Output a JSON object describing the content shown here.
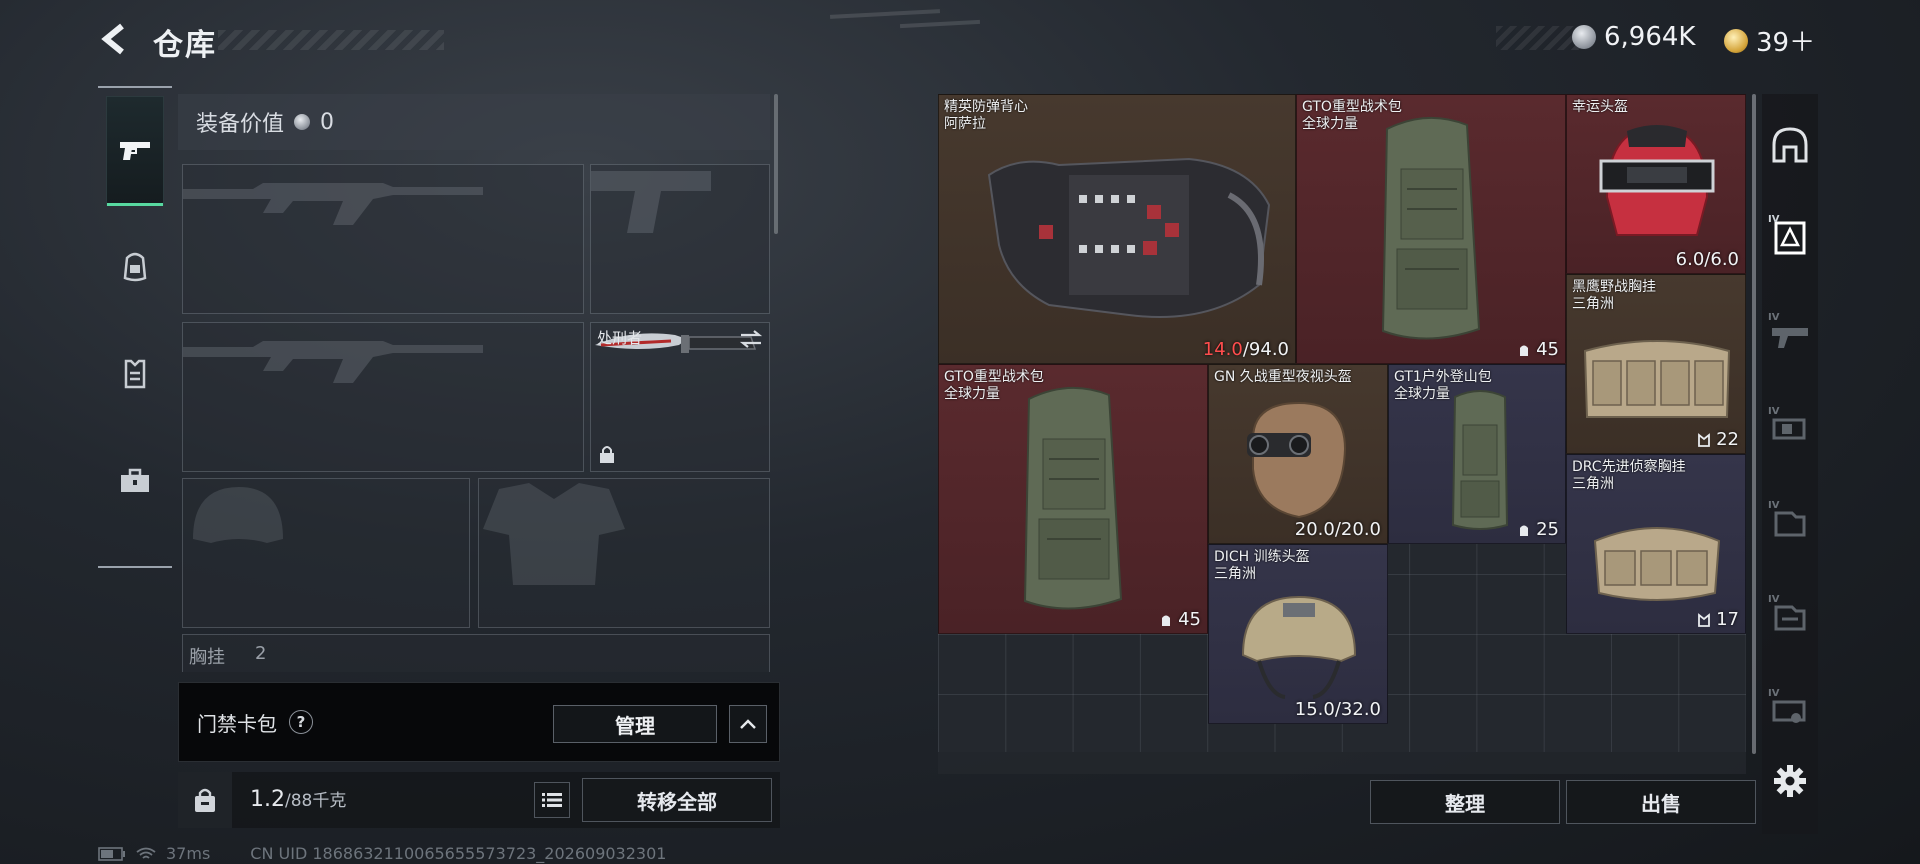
{
  "header": {
    "title": "仓库",
    "silver_value": "6,964K",
    "gold_value": "39＋"
  },
  "left_rail": {
    "tabs": [
      {
        "name": "pistol-icon",
        "active": true
      },
      {
        "name": "backpack-icon",
        "active": false
      },
      {
        "name": "armor-vest-icon",
        "active": false
      },
      {
        "name": "toolbox-icon",
        "active": false
      }
    ]
  },
  "loadout": {
    "equip_value_label": "装备价值",
    "equip_value": "0",
    "melee_slot_label": "处刑者",
    "chest_rig_label": "胸挂",
    "chest_rig_count": "2"
  },
  "card_bag": {
    "label": "门禁卡包",
    "help_symbol": "?",
    "manage_label": "管理"
  },
  "weight": {
    "current": "1.2",
    "max": "/88千克",
    "transfer_all_label": "转移全部"
  },
  "status": {
    "ping": "37ms",
    "uid": "CN UID 1868632110065655573723_202609032301"
  },
  "stash": {
    "items": [
      {
        "id": "vest",
        "name1": "精英防弹背心",
        "name2": "阿萨拉",
        "value_red": "14.0",
        "value": "/94.0"
      },
      {
        "id": "pack1",
        "name1": "GTO重型战术包",
        "name2": "全球力量",
        "value": "45"
      },
      {
        "id": "helmet-lucky",
        "name1": "幸运头盔",
        "name2": "",
        "value": "6.0/6.0"
      },
      {
        "id": "rig-eagle",
        "name1": "黑鹰野战胸挂",
        "name2": "三角洲",
        "value": "22"
      },
      {
        "id": "pack2",
        "name1": "GTO重型战术包",
        "name2": "全球力量",
        "value": "45"
      },
      {
        "id": "nv-helmet",
        "name1": "GN 久战重型夜视头盔",
        "name2": "",
        "value": "20.0/20.0"
      },
      {
        "id": "gt1-pack",
        "name1": "GT1户外登山包",
        "name2": "全球力量",
        "value": "25"
      },
      {
        "id": "rig-drc",
        "name1": "DRC先进侦察胸挂",
        "name2": "三角洲",
        "value": "17"
      },
      {
        "id": "dich-helmet",
        "name1": "DICH 训练头盔",
        "name2": "三角洲",
        "value": "15.0/32.0"
      }
    ],
    "sort_label": "整理",
    "sell_label": "出售"
  },
  "right_rail": {
    "tabs": [
      {
        "name": "all-items-icon",
        "tier": ""
      },
      {
        "name": "armor-filter-icon",
        "tier": "IV"
      },
      {
        "name": "weapon-filter-icon",
        "tier": "IV"
      },
      {
        "name": "attachment-filter-icon",
        "tier": "IV"
      },
      {
        "name": "ammo-filter-icon",
        "tier": "IV"
      },
      {
        "name": "consumable-filter-icon",
        "tier": "IV"
      },
      {
        "name": "misc-filter-icon",
        "tier": "IV"
      },
      {
        "name": "settings-gear-icon",
        "tier": ""
      }
    ]
  },
  "colors": {
    "accent": "#58d9a0",
    "rarity_brown": "#47392e",
    "rarity_red": "#5a2a2e",
    "rarity_navy": "#35354a",
    "damage_red": "#ff4d4d"
  }
}
